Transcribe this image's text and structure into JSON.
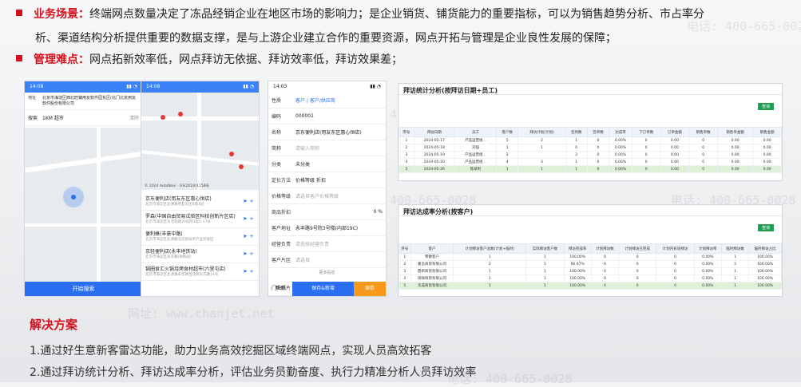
{
  "bullets": [
    {
      "label": "业务场景：",
      "text": "终端网点数量决定了冻品经销企业在地区市场的影响力；是企业销货、铺货能力的重要指标，可以为销售趋势分析、市占率分",
      "cont": "析、渠道结构分析提供重要的数据支撑，是与上游企业建立合作的重要资源，网点开拓与管理是企业良性发展的保障；"
    },
    {
      "label": "管理难点：",
      "text": "网点拓新效率低，网点拜访无依据、拜访效率低，拜访效果差；"
    }
  ],
  "watermark": {
    "phone": "电话: 400-665-0028",
    "site": "网址: www.chanjet.net"
  },
  "phone1": {
    "time": "14:08",
    "addr_label": "地址",
    "addr": "北京市海淀区西北旺镇用友软件园东区(北门北京用友软件股份有限公司",
    "search_label": "搜索",
    "search_value": "1KM 超市",
    "clear": "清除",
    "btn": "开始搜索"
  },
  "phone2": {
    "time": "14:08",
    "map_caption": "© 2024 AutoNavi - GS(2024)1158号",
    "list": [
      {
        "t": "京东便利店(用友东区惠心恒店)",
        "s": "北京市海淀区北清路用友东区B座1层"
      },
      {
        "t": "罗森(中国自由贸易试验区科技创新片区店)",
        "s": "北京市海淀区东北旺路30号院1层1-17号"
      },
      {
        "t": "便利蜂(丰豪中路)",
        "s": "北京市海淀区北清路北京新技术产业开发区"
      },
      {
        "t": "京轻便利店(永丰地铁站)",
        "s": "北京市海淀区永丰路(地铁站)"
      },
      {
        "t": "锅圈食汇火锅烧烤食材超市(六里屯店)",
        "s": "北京市海淀区北清路永丰路西北侧东方路14号"
      }
    ]
  },
  "phone3": {
    "time": "14:03",
    "rows": [
      {
        "l": "性质",
        "v": "客户 / 客户/供应商"
      },
      {
        "l": "编码",
        "v": "000001"
      },
      {
        "l": "名称",
        "v": "京东便利店(用友东区惠心恒店)"
      },
      {
        "l": "简称",
        "v": "请输入简称"
      },
      {
        "l": "分类",
        "v": "未分类"
      },
      {
        "l": "定价方法",
        "v": "价格等级  折扣"
      },
      {
        "l": "价格等级",
        "v": "请选择客户价格等级"
      },
      {
        "l": "商品折扣",
        "v": "0 %"
      },
      {
        "l": "客户地址",
        "v": "永丰路9号院3号楼(内部19C)"
      },
      {
        "l": "经营负责",
        "v": "请选择经营负责"
      },
      {
        "l": "客户片区",
        "v": "请选择"
      }
    ],
    "more": "更多信息",
    "photo": "门头照片",
    "help": "帮助",
    "save_new": "保存&新增",
    "save": "保存"
  },
  "panel1": {
    "title": "拜访统计分析(按拜访日期+员工)",
    "headers": [
      "序号",
      "拜访日期",
      "员工",
      "客户数",
      "拜访计划(计划)",
      "签到数",
      "签单数",
      "达成率",
      "下订单数",
      "订单金额",
      "销售单数",
      "销售单金额",
      "销售金额"
    ],
    "rows": [
      [
        "1",
        "2024-05-17",
        "产品运营组...",
        "5",
        "2",
        "1",
        "0",
        "0.00%",
        "0",
        "0.00",
        "0",
        "0.00",
        "0.00"
      ],
      [
        "2",
        "2024-05-18",
        "刘强",
        "1",
        "1",
        "0",
        "0",
        "0.00%",
        "0",
        "0.00",
        "0",
        "0.00",
        "0.00"
      ],
      [
        "3",
        "2024-05-19",
        "产品运营组...",
        "2",
        "",
        "2",
        "0",
        "0.00%",
        "0",
        "0.00",
        "0",
        "0.00",
        "0.00"
      ],
      [
        "4",
        "2024-05-20",
        "产品运营组...",
        "4",
        "3",
        "1",
        "0",
        "0.00%",
        "0",
        "0.00",
        "0",
        "0.00",
        "0.00"
      ],
      [
        "5",
        "2024-05-26",
        "陈某利",
        "1",
        "1",
        "1",
        "0",
        "0.00%",
        "0",
        "0.00",
        "0",
        "0.00",
        "0.00"
      ]
    ],
    "query": "查询"
  },
  "panel2": {
    "title": "拜访达成率分析(按客户)",
    "headers": [
      "序号",
      "客户",
      "计划拜访客户总数(计划+临时)",
      "实际拜访客户数",
      "拜访完成率",
      "计划拜访数",
      "计划拜访已完成",
      "计划内有效拜访",
      "计划拜访率",
      "临时拜访数",
      "临时拜访占比"
    ],
    "rows": [
      [
        "1",
        "零散客户",
        "1",
        "1",
        "100.00%",
        "0",
        "0",
        "0",
        "0.00%",
        "1",
        "100.00%"
      ],
      [
        "2",
        "嘉吾商贸有限公司",
        "2",
        "1",
        "66.67%",
        "0",
        "0",
        "0",
        "0.00%",
        "2",
        "100.00%"
      ],
      [
        "3",
        "鼎新商贸有限公司",
        "1",
        "1",
        "100.00%",
        "0",
        "0",
        "0",
        "0.00%",
        "1",
        "100.00%"
      ],
      [
        "4",
        "瑞祥商贸有限公司",
        "1",
        "1",
        "100.00%",
        "0",
        "0",
        "0",
        "0.00%",
        "1",
        "100.00%"
      ],
      [
        "5",
        "华成商贸有限公司",
        "1",
        "1",
        "100.00%",
        "0",
        "0",
        "0",
        "0.00%",
        "1",
        "100.00%"
      ]
    ],
    "query": "查询"
  },
  "solution": {
    "title": "解决方案",
    "lines": [
      "1.通过好生意新客雷达功能，助力业务高效挖掘区域终端网点，实现人员高效拓客",
      "2.通过拜访统计分析、拜访达成率分析，评估业务员勤奋度、执行力精准分析人员拜访效率"
    ]
  }
}
